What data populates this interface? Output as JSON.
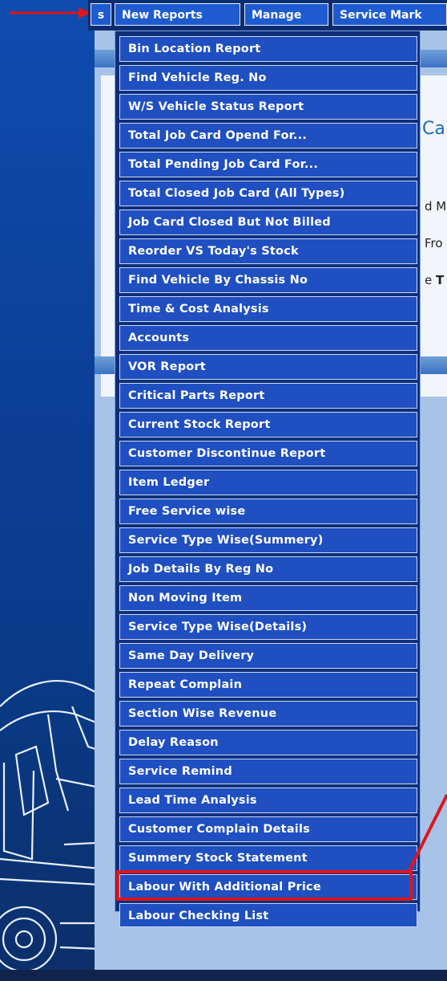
{
  "menubar": {
    "cut_tab": "s",
    "tabs": [
      "New Reports",
      "Manage",
      "Service Mark"
    ]
  },
  "background": {
    "title_fragment": "Ca",
    "line1": "d M",
    "line2": "Fro",
    "line3_prefix": "e ",
    "line3_bold": "T"
  },
  "dropdown": {
    "items": [
      "Bin Location Report",
      "Find Vehicle Reg. No",
      "W/S Vehicle Status Report",
      "Total Job Card Opend For...",
      "Total Pending Job Card For...",
      "Total Closed Job Card (All Types)",
      "Job Card Closed But Not Billed",
      "Reorder VS Today's Stock",
      "Find Vehicle By Chassis No",
      "Time & Cost Analysis",
      "Accounts",
      "VOR Report",
      "Critical Parts Report",
      "Current Stock Report",
      "Customer Discontinue Report",
      "Item Ledger",
      "Free Service wise",
      "Service Type Wise(Summery)",
      "Job Details By Reg No",
      "Non Moving Item",
      "Service Type Wise(Details)",
      "Same Day Delivery",
      "Repeat Complain",
      "Section Wise Revenue",
      "Delay Reason",
      "Service Remind",
      "Lead Time Analysis",
      "Customer Complain Details",
      "Summery Stock Statement",
      "Labour With Additional Price",
      "Labour Checking List"
    ],
    "highlighted": "Labour Checking List"
  },
  "annotation_color": "#e0141a",
  "item_color": "#1f4fc0",
  "icons": [
    "arrow-right-icon",
    "truck-illustration"
  ]
}
